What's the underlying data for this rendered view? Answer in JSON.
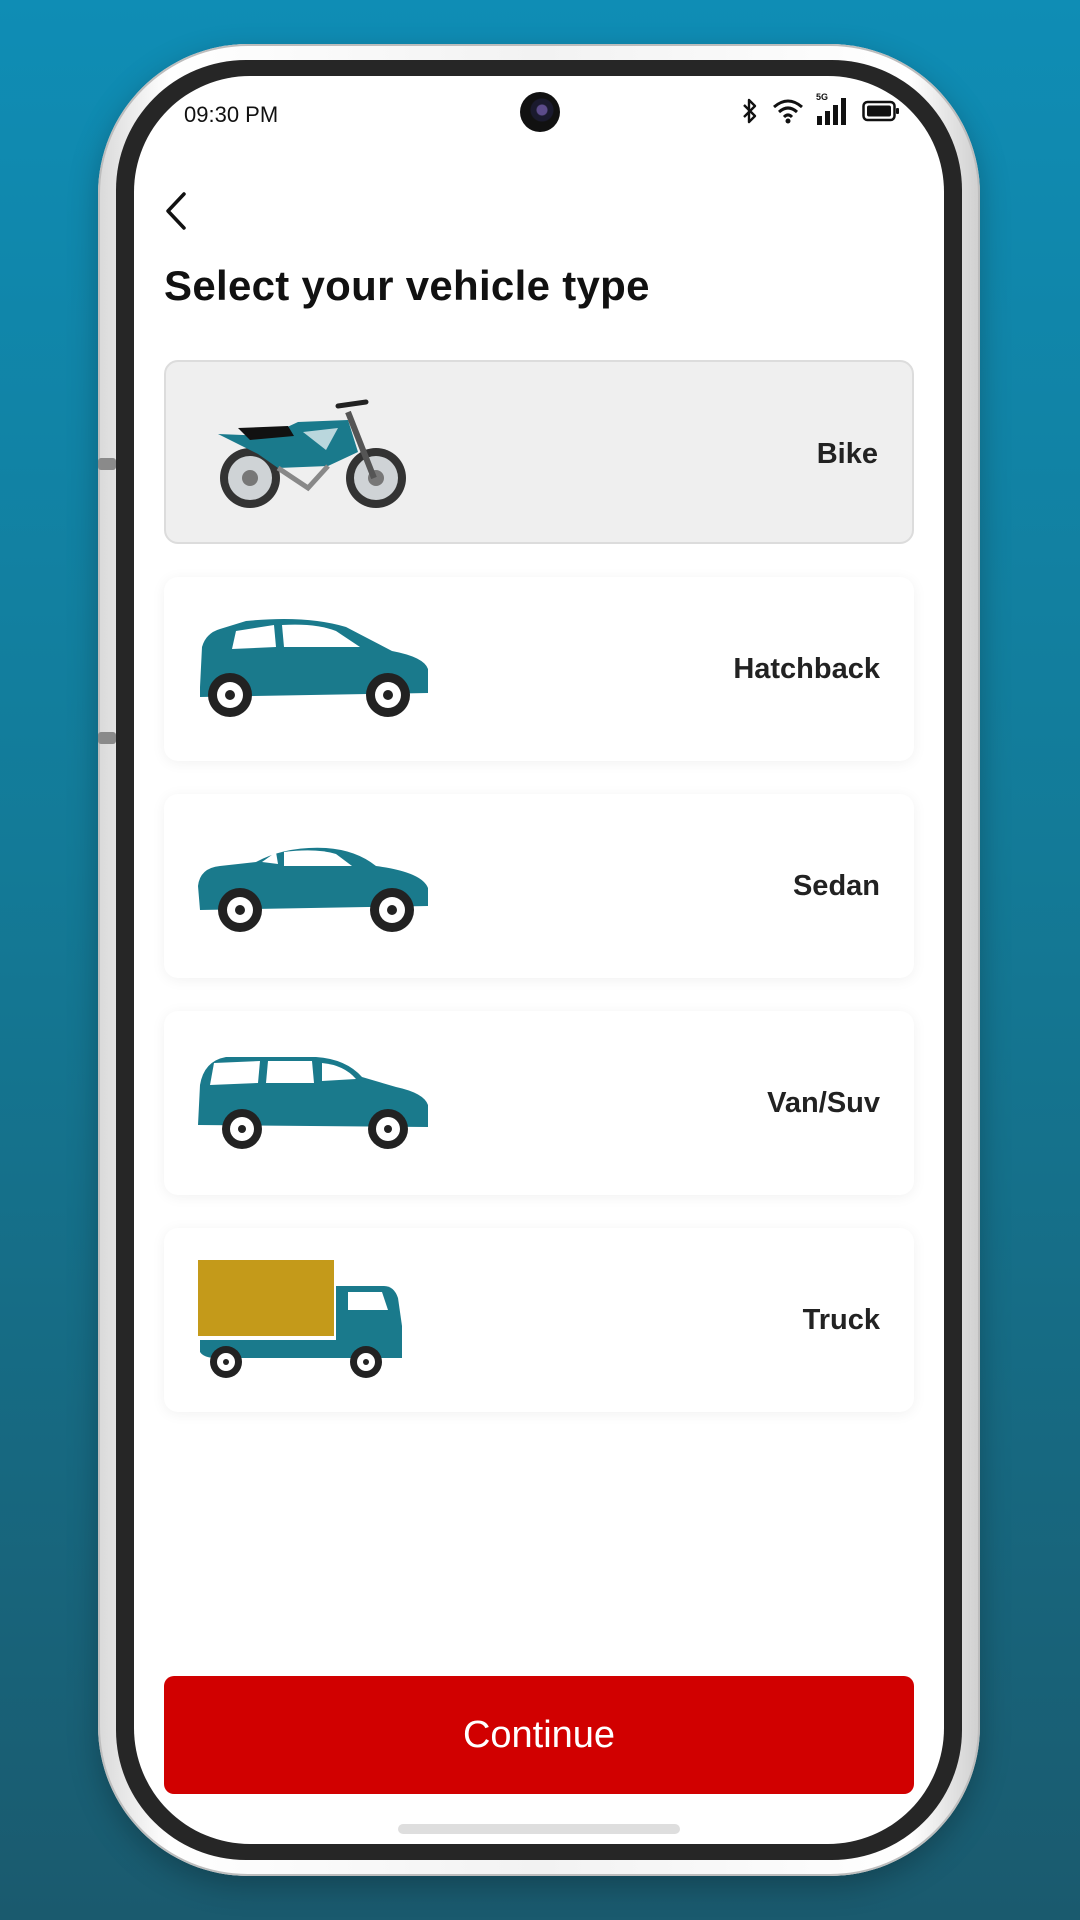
{
  "status_bar": {
    "time": "09:30 PM",
    "icons": [
      "bluetooth-icon",
      "wifi-icon",
      "5g-signal-icon",
      "battery-icon"
    ],
    "network_label": "5G"
  },
  "header": {
    "back_icon": "chevron-left-icon",
    "title": "Select your vehicle type"
  },
  "vehicles": [
    {
      "label": "Bike",
      "icon": "motorbike-icon",
      "selected": true
    },
    {
      "label": "Hatchback",
      "icon": "hatchback-icon",
      "selected": false
    },
    {
      "label": "Sedan",
      "icon": "sedan-icon",
      "selected": false
    },
    {
      "label": "Van/Suv",
      "icon": "van-icon",
      "selected": false
    },
    {
      "label": "Truck",
      "icon": "truck-icon",
      "selected": false
    }
  ],
  "footer": {
    "continue_label": "Continue"
  },
  "colors": {
    "accent": "#d10000",
    "vehicle_teal": "#1a7a8c",
    "truck_cargo": "#c49a1a",
    "selected_card": "#efefef"
  }
}
